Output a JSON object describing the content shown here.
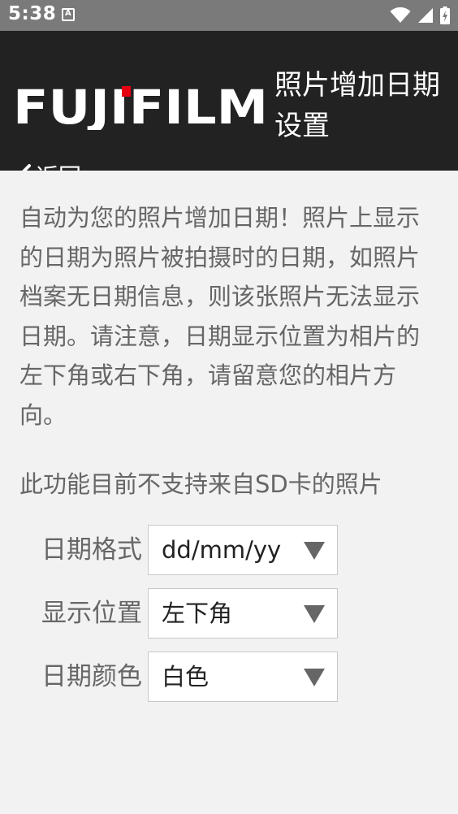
{
  "status_bar": {
    "time": "5:38",
    "icons": [
      "notification-icon",
      "wifi-icon",
      "signal-icon",
      "battery-icon"
    ]
  },
  "header": {
    "logo_text": "FUJIFILM",
    "title": "照片增加日期设置",
    "back_label": "返回"
  },
  "content": {
    "description": "自动为您的照片增加日期！照片上显示的日期为照片被拍摄时的日期，如照片档案无日期信息，则该张照片无法显示日期。请注意，日期显示位置为相片的左下角或右下角，请留意您的相片方向。",
    "sd_note": "此功能目前不支持来自SD卡的照片",
    "settings": [
      {
        "label": "日期格式",
        "value": "dd/mm/yy"
      },
      {
        "label": "显示位置",
        "value": "左下角"
      },
      {
        "label": "日期颜色",
        "value": "白色"
      }
    ]
  },
  "colors": {
    "header_bg": "#222222",
    "status_bg": "#7a7a7a",
    "content_bg": "#f2f2f2",
    "logo_accent": "#e60012",
    "text_gray": "#666666"
  }
}
